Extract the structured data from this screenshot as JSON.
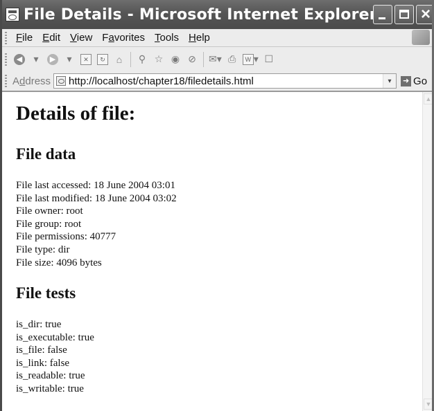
{
  "window": {
    "title": "File Details - Microsoft Internet Explorer"
  },
  "menu": [
    {
      "accel": "F",
      "rest": "ile"
    },
    {
      "accel": "E",
      "rest": "dit"
    },
    {
      "accel": "V",
      "rest": "iew"
    },
    {
      "pre": "F",
      "accel": "a",
      "rest": "vorites"
    },
    {
      "accel": "T",
      "rest": "ools"
    },
    {
      "accel": "H",
      "rest": "elp"
    }
  ],
  "address": {
    "label_pre": "A",
    "label_accel": "d",
    "label_rest": "dress",
    "url": "http://localhost/chapter18/filedetails.html",
    "go_label": "Go"
  },
  "page": {
    "heading": "Details of file:",
    "file_data": {
      "heading": "File data",
      "lines": [
        "File last accessed: 18 June 2004 03:01",
        "File last modified: 18 June 2004 03:02",
        "File owner: root",
        "File group: root",
        "File permissions: 40777",
        "File type: dir",
        "File size: 4096 bytes"
      ]
    },
    "file_tests": {
      "heading": "File tests",
      "lines": [
        "is_dir: true",
        "is_executable: true",
        "is_file: false",
        "is_link: false",
        "is_readable: true",
        "is_writable: true"
      ]
    }
  },
  "icons": {
    "title": "ie-page-icon",
    "toolbar": [
      "back-icon",
      "dropdown-icon",
      "forward-icon",
      "dropdown-icon",
      "stop-icon",
      "refresh-icon",
      "home-icon",
      "search-icon",
      "favorites-icon",
      "media-icon",
      "history-icon",
      "mail-icon",
      "print-icon",
      "edit-icon",
      "discuss-icon"
    ]
  }
}
